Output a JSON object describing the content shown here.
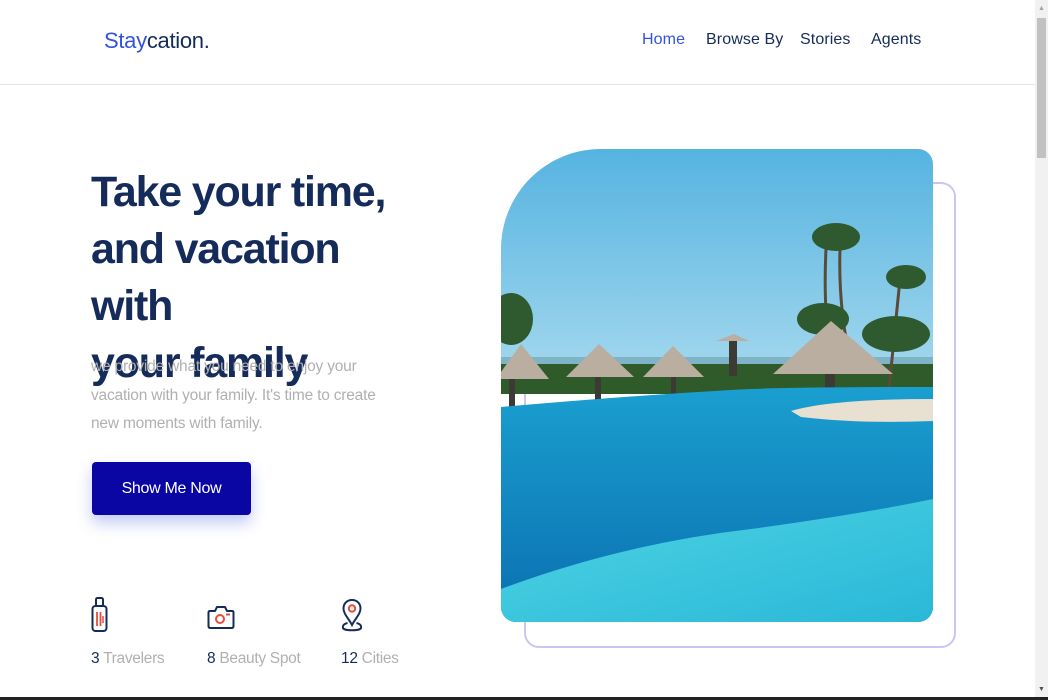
{
  "header": {
    "logo": {
      "part1": "Stay",
      "part2": "cation."
    },
    "nav": [
      {
        "label": "Home",
        "active": true
      },
      {
        "label": "Browse By",
        "active": false
      },
      {
        "label": "Stories",
        "active": false
      },
      {
        "label": "Agents",
        "active": false
      }
    ]
  },
  "hero": {
    "title_lines": [
      "Take your time,",
      "and vacation with",
      "your family"
    ],
    "description": "we provide what you need to enjoy your vacation with your family. It's time to create new moments with family.",
    "cta_label": "Show Me Now",
    "image_alt": "Resort pool with thatched umbrellas and palm trees",
    "stats": [
      {
        "icon": "luggage-icon",
        "number": "3",
        "label": "Travelers"
      },
      {
        "icon": "camera-icon",
        "number": "8",
        "label": "Beauty Spot"
      },
      {
        "icon": "map-pin-icon",
        "number": "12",
        "label": "Cities"
      }
    ]
  },
  "colors": {
    "primary": "#3252df",
    "dark_navy": "#152c5b",
    "button": "#0a06a3",
    "muted_text": "#b0b0b0",
    "icon_accent": "#e74c3c",
    "frame_border": "#c9c6f0"
  },
  "scrollbar": {
    "up_glyph": "▲",
    "down_glyph": "▼"
  }
}
